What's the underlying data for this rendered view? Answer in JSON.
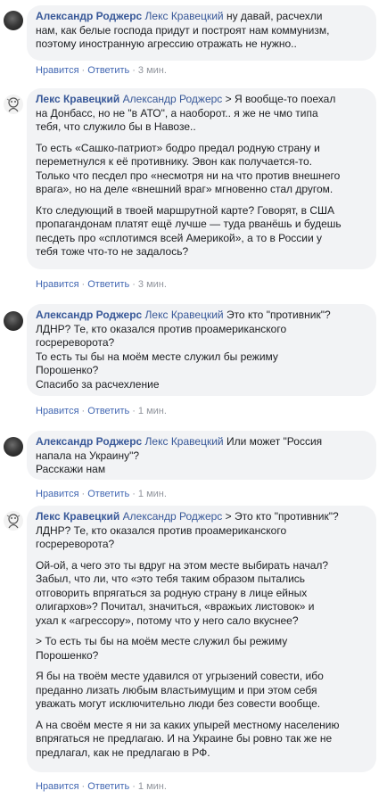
{
  "action_labels": {
    "like": "Нравится",
    "reply": "Ответить",
    "separator": "·"
  },
  "comments": [
    {
      "author": "Александр Роджерс",
      "mention": "Лекс Кравецкий",
      "first_line_rest": " ну давай, расчехли\nнам, как белые господа придут и построят нам коммунизм,\nпоэтому иностранную агрессию отражать не нужно..",
      "paragraphs": [],
      "time": "3 мин."
    },
    {
      "author": "Лекс Кравецкий",
      "mention": "Александр Роджерс",
      "first_line_rest": " > Я вообще-то поехал\nна Донбасс, но не \"в АТО\", а наоборот.. я же не чмо типа\nтебя, что служило бы в Навозе..",
      "paragraphs": [
        "То есть «Сашко-патриот» бодро предал родную страну и\nпереметнулся к её противнику. Эвон как получается-то.\nТолько что песдел про «несмотря ни на что против внешнего\nврага», но на деле «внешний враг» мгновенно стал другом.",
        "Кто следующий в твоей маршрутной карте? Говорят, в США\nпропагандонам платят ещё лучше — туда рванёшь и будешь\nпесдеть про «сплотимся всей Америкой», а то в России у\nтебя тоже что-то не задалось?"
      ],
      "time": "3 мин."
    },
    {
      "author": "Александр Роджерс",
      "mention": "Лекс Кравецкий",
      "first_line_rest": " Это кто \"противник\"?\nЛДНР? Те, кто оказался против проамериканского\nгосререворота?\nТо есть ты бы на моём месте служил бы режиму\nПорошенко?\nСпасибо за расчехление",
      "paragraphs": [],
      "time": "1 мин."
    },
    {
      "author": "Александр Роджерс",
      "mention": "Лекс Кравецкий",
      "first_line_rest": " Или может \"Россия\nнапала на Украину\"?\nРасскажи нам",
      "paragraphs": [],
      "time": "1 мин."
    },
    {
      "author": "Лекс Кравецкий",
      "mention": "Александр Роджерс",
      "first_line_rest": " > Это кто \"противник\"?\nЛДНР? Те, кто оказался против проамериканского\nгосререворота?",
      "paragraphs": [
        "Ой-ой, а чего это ты вдруг на этом месте выбирать начал?\nЗабыл, что ли, что «это тебя таким образом пытались\nотговорить впрягаться за родную страну в лице ейных\nолигархов»? Почитал, значиться, «вражьих листовок» и\nухал к «агрессору», потому что у него сало вкуснее?",
        "> То есть ты бы на моём месте служил бы режиму\nПорошенко?",
        "Я бы на твоём месте удавился от угрызений совести, ибо\nпреданно лизать любым властьимущим и при этом себя\nуважать могут исключительно люди без совести вообще.",
        "А на своём месте я ни за каких упырей местному населению\nвпрягаться не предлагаю. И на Украине бы ровно так же не\nпредлагал, как не предлагаю в РФ."
      ],
      "time": "1 мин."
    }
  ]
}
